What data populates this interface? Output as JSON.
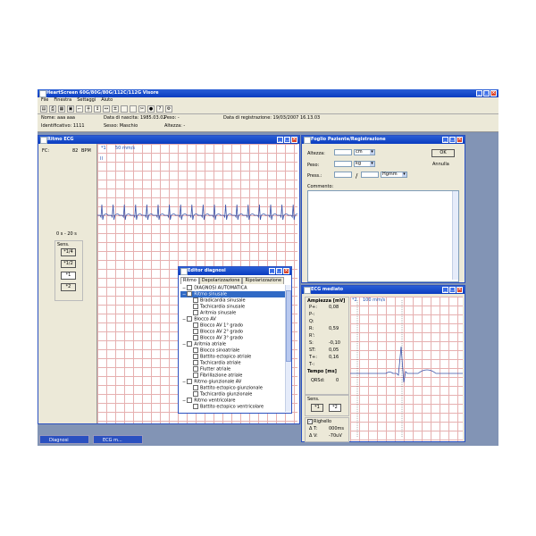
{
  "app": {
    "title": "HeartScreen 60G/80G/80G/112C/112G Visore",
    "menu": [
      "File",
      "Finestra",
      "Settaggi",
      "Aiuto"
    ]
  },
  "patient": {
    "name": "Nome: aaa aaa",
    "id": "Identificativo: 1111",
    "birth": "Data di nascita: 1985.03.02",
    "sex": "Sesso: Maschio",
    "weight": "Peso: -",
    "height": "Altezza: -",
    "recording": "Data di registrazione: 19/03/2007 16.13.03"
  },
  "ritmo": {
    "title": "Ritmo ECG",
    "fc_label": "FC:",
    "fc_value": "82",
    "fc_unit": "BPM",
    "time_range": "0 s - 20 s",
    "sens_label": "Sens.",
    "sens": [
      "*1/4",
      "*1/2",
      "*1",
      "*2"
    ],
    "lead_label": "*1",
    "speed_label": "50 mm/s",
    "channel": "II"
  },
  "foglio": {
    "title": "Foglio Paziente/Registrazione",
    "altezza_label": "Altezza:",
    "altezza_unit": "cm",
    "peso_label": "Peso:",
    "peso_unit": "kg",
    "press_label": "Press.:",
    "press_sep": "/",
    "press_unit": "Hgmm",
    "commento_label": "Commento:",
    "ok_label": "OK",
    "annulla_label": "Annulla"
  },
  "editor": {
    "title": "Editor diagnosi",
    "tabs": [
      "Ritmo",
      "Depolarizzazione",
      "Ripolarizzazione"
    ],
    "items": [
      {
        "label": "DIAGNOSI AUTOMATICA",
        "level": 1,
        "selected": false,
        "expander": true
      },
      {
        "label": "Ritmo sinusale",
        "level": 1,
        "selected": true,
        "expander": true
      },
      {
        "label": "Bradicardia sinusale",
        "level": 2
      },
      {
        "label": "Tachicardia sinusale",
        "level": 2
      },
      {
        "label": "Aritmia sinusale",
        "level": 2
      },
      {
        "label": "Blocco AV",
        "level": 1,
        "expander": true
      },
      {
        "label": "Blocco AV 1° grado",
        "level": 2
      },
      {
        "label": "Blocco AV 2° grado",
        "level": 2
      },
      {
        "label": "Blocco AV 3° grado",
        "level": 2
      },
      {
        "label": "Aritmia atriale",
        "level": 1,
        "expander": true
      },
      {
        "label": "Blocco sinoatriale",
        "level": 2
      },
      {
        "label": "Battito ectopico atriale",
        "level": 2
      },
      {
        "label": "Tachicardia atriale",
        "level": 2
      },
      {
        "label": "Flutter atriale",
        "level": 2
      },
      {
        "label": "Fibrillazione atriale",
        "level": 2
      },
      {
        "label": "Ritmo giunzionale AV",
        "level": 1,
        "expander": true
      },
      {
        "label": "Battito ectopico giunzionale",
        "level": 2
      },
      {
        "label": "Tachicardia giunzionale",
        "level": 2
      },
      {
        "label": "Ritmo ventricolare",
        "level": 1,
        "expander": true
      },
      {
        "label": "Battito ectopico ventricolare",
        "level": 2
      }
    ]
  },
  "mediato": {
    "title": "ECG mediato",
    "ampiezza_label": "Ampiezza [mV]",
    "rows": [
      {
        "k": "P+:",
        "v": "0,08"
      },
      {
        "k": "P-:",
        "v": ""
      },
      {
        "k": "Q:",
        "v": ""
      },
      {
        "k": "R:",
        "v": "0,59"
      },
      {
        "k": "R':",
        "v": ""
      },
      {
        "k": "S:",
        "v": "-0,10"
      },
      {
        "k": "ST:",
        "v": "0,05"
      },
      {
        "k": "T+:",
        "v": "0,16"
      },
      {
        "k": "T-:",
        "v": ""
      }
    ],
    "tempo_label": "Tempo [ms]",
    "qrs_label": "QRSd:",
    "qrs_value": "0",
    "sens_label": "Sens.",
    "sens": [
      "*1",
      "*2"
    ],
    "righello_label": "Righello",
    "dt_label": "Δ T:",
    "dt_value": "000ms",
    "dv_label": "Δ V:",
    "dv_value": "-70uV",
    "lead_label": "*2",
    "speed_label": "100 mm/s"
  },
  "taskbar": [
    {
      "label": "Diagnosi"
    },
    {
      "label": "ECG m..."
    }
  ]
}
